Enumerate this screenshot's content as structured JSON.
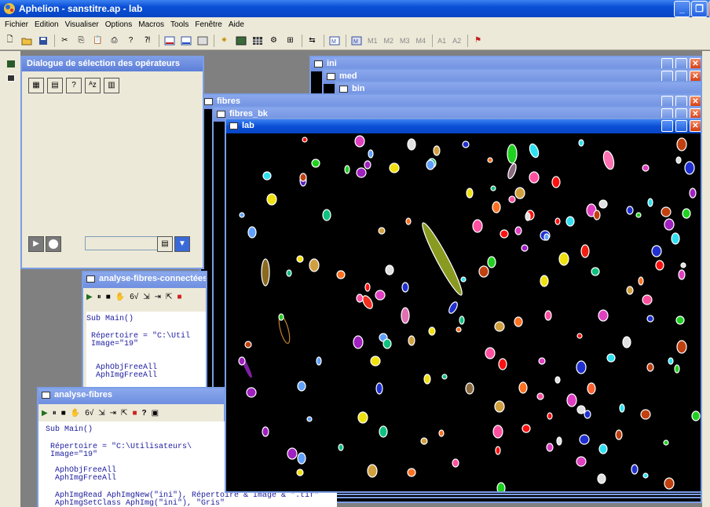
{
  "app": {
    "title": "Aphelion - sanstitre.ap - lab"
  },
  "menu": [
    "Fichier",
    "Edition",
    "Visualiser",
    "Options",
    "Macros",
    "Tools",
    "Fenêtre",
    "Aide"
  ],
  "toolbar": {
    "text_buttons": [
      "M1",
      "M2",
      "M3",
      "M4",
      "A1",
      "A2"
    ]
  },
  "dialog": {
    "title": "Dialogue de sélection des opérateurs"
  },
  "windows": {
    "ini": "ini",
    "med": "med",
    "bin": "bin",
    "fibres": "fibres",
    "fibres_bk": "fibres_bk",
    "lab": "lab"
  },
  "macro1": {
    "title": "analyse-fibres-connectées",
    "lines": [
      "Sub Main()",
      "",
      " Répertoire = \"C:\\Util",
      " Image=\"19\"",
      "",
      "",
      "  AphObjFreeAll",
      "  AphImgFreeAll"
    ]
  },
  "macro2": {
    "title": "analyse-fibres",
    "lines": [
      "Sub Main()",
      "",
      " Répertoire = \"C:\\Utilisateurs\\",
      " Image=\"19\"",
      "",
      "  AphObjFreeAll",
      "  AphImgFreeAll",
      "",
      "  AphImgRead AphImgNew(\"ini\"), Répertoire & Image & \".tif\"",
      "  AphImgSetClass AphImg(\"ini\"), \"Gris\""
    ]
  },
  "colors": {
    "xp_blue": "#0a4fd6",
    "inactive_blue": "#7b9de6",
    "code_text": "#1b1b9e"
  }
}
